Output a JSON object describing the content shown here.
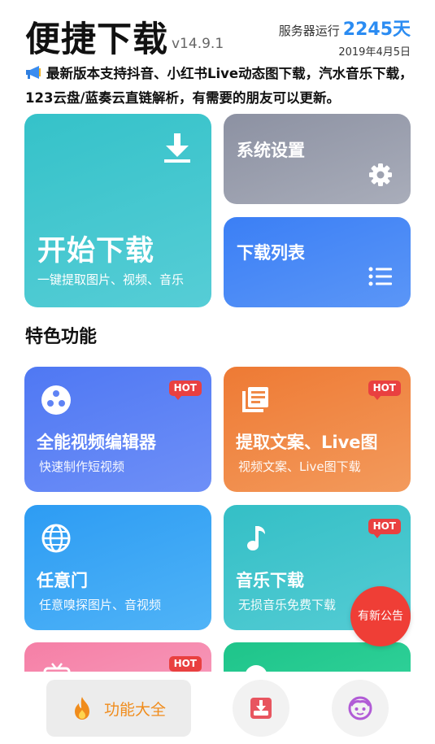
{
  "header": {
    "title": "便捷下载",
    "version": "v14.9.1",
    "uptime_label": "服务器运行",
    "uptime_value": "2245天",
    "start_date": "2019年4月5日"
  },
  "notice": {
    "icon": "megaphone-icon",
    "text": "最新版本支持抖音、小红书Live动态图下载，汽水音乐下载，123云盘/蓝奏云直链解析，有需要的朋友可以更新。"
  },
  "main_cards": {
    "start": {
      "title": "开始下载",
      "subtitle": "一键提取图片、视频、音乐",
      "icon": "download-icon",
      "color": "#40c6ce"
    },
    "settings": {
      "title": "系统设置",
      "icon": "gear-icon",
      "color": "#969aaa"
    },
    "download_list": {
      "title": "下载列表",
      "icon": "list-icon",
      "color": "#4a8af6"
    }
  },
  "section": {
    "title": "特色功能"
  },
  "features": [
    {
      "title": "全能视频编辑器",
      "subtitle": "快速制作短视频",
      "badge": "HOT",
      "icon": "film-reel-icon",
      "color": "#5f83f5"
    },
    {
      "title": "提取文案、Live图",
      "subtitle": "视频文案、Live图下载",
      "badge": "HOT",
      "icon": "document-stack-icon",
      "color": "#f08a48"
    },
    {
      "title": "任意门",
      "subtitle": "任意嗅探图片、音视频",
      "badge": "",
      "icon": "globe-icon",
      "color": "#3aa8f5"
    },
    {
      "title": "音乐下载",
      "subtitle": "无损音乐免费下载",
      "badge": "HOT",
      "icon": "music-note-icon",
      "color": "#44c6cd"
    },
    {
      "title": "",
      "subtitle": "",
      "badge": "HOT",
      "icon": "tv-icon",
      "color": "#f68aae"
    },
    {
      "title": "",
      "subtitle": "",
      "badge": "",
      "icon": "circle-icon",
      "color": "#26ca91"
    }
  ],
  "floating_button": {
    "label": "有新公告",
    "color": "#ef3e36"
  },
  "bottom_nav": {
    "features_label": "功能大全",
    "features_icon": "flame-icon",
    "download_icon": "download-box-icon",
    "profile_icon": "face-icon",
    "active_color": "#f08c1c"
  }
}
